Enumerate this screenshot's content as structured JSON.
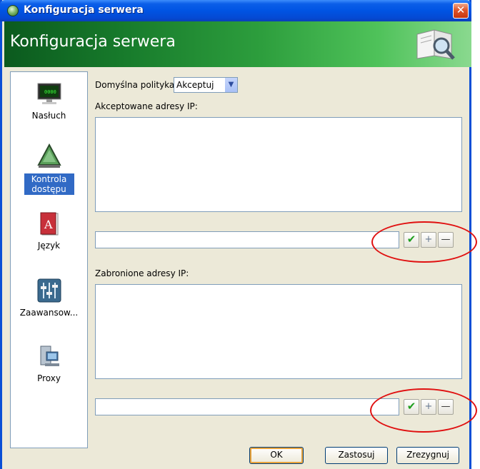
{
  "window": {
    "title": "Konfiguracja serwera",
    "close_glyph": "✕"
  },
  "header": {
    "title": "Konfiguracja serwera",
    "icon": "book-search-icon"
  },
  "sidebar": {
    "items": [
      {
        "label": "Nasłuch",
        "icon": "monitor-icon"
      },
      {
        "label": "Kontrola dostępu",
        "icon": "triangle-access-icon",
        "selected": true
      },
      {
        "label": "Język",
        "icon": "language-book-icon"
      },
      {
        "label": "Zaawansow...",
        "icon": "sliders-icon"
      },
      {
        "label": "Proxy",
        "icon": "proxy-computer-icon"
      }
    ]
  },
  "policy": {
    "label": "Domyślna polityka",
    "value": "Akceptuj"
  },
  "accepted": {
    "label": "Akceptowane adresy IP:",
    "input_value": ""
  },
  "denied": {
    "label": "Zabronione adresy IP:",
    "input_value": ""
  },
  "tool_buttons": {
    "ok": "✔",
    "add": "+",
    "remove": "—"
  },
  "footer": {
    "ok": "OK",
    "apply": "Zastosuj",
    "cancel": "Zrezygnuj"
  },
  "colors": {
    "accent": "#316ac5",
    "header_green": "#177a2b",
    "highlight_circle": "#e01010"
  }
}
